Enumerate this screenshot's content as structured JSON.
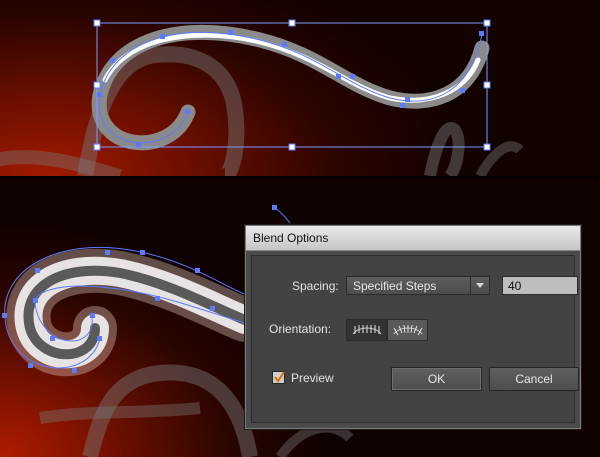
{
  "dialog": {
    "title": "Blend Options",
    "spacing_label": "Spacing:",
    "spacing_value": "Specified Steps",
    "steps_value": "40",
    "orientation_label": "Orientation:",
    "orientation_options": [
      "align-to-page-icon",
      "align-to-path-icon"
    ],
    "preview_label": "Preview",
    "preview_checked": true,
    "ok_label": "OK",
    "cancel_label": "Cancel"
  },
  "colors": {
    "selection": "#5a7bff",
    "dialog_bg": "#4b4b4b",
    "background_red": "#a21a00"
  }
}
